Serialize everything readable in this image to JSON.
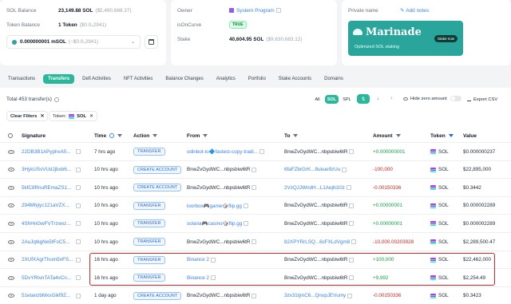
{
  "account": {
    "sol_balance_label": "SOL Balance",
    "sol_balance_value": "23,149.88 SOL",
    "sol_balance_usd": "($5,490,688.37)",
    "token_balance_label": "Token Balance",
    "token_balance_value": "1 Token",
    "token_balance_usd": "($0.0₂2941)",
    "token_select_value": "0.000000001 mSOL",
    "token_select_usd": "(~$0.0₂2941)"
  },
  "owner": {
    "owner_label": "Owner",
    "owner_value": "System Program",
    "oncurve_label": "isOnCurve",
    "oncurve_value": "TRUE",
    "stake_label": "Stake",
    "stake_value": "40,604.95 SOL",
    "stake_usd": "($9,630,683.12)"
  },
  "private": {
    "label": "Private name",
    "add_notes": "Add notes"
  },
  "banner": {
    "brand": "Marinade",
    "tagline": "Optimized SOL staking",
    "button": "Stake now",
    "colors": {
      "bg": "#2aa59b"
    }
  },
  "tabs": [
    "Transactions",
    "Transfers",
    "Defi Activities",
    "NFT Activities",
    "Balance Changes",
    "Analytics",
    "Portfolio",
    "Stake Accounts",
    "Domains"
  ],
  "active_tab": "Transfers",
  "toolbar": {
    "total": "Total 453 transfer(s)",
    "seg_all": "All",
    "seg_sol": "SOL",
    "seg_spl": "SPL",
    "hide_zero": "Hide zero amount",
    "export": "Export CSV",
    "clear_filters": "Clear Filters",
    "token_filter_label": "Token:",
    "token_filter_value": "SOL"
  },
  "columns": {
    "signature": "Signature",
    "time": "Time",
    "action": "Action",
    "from": "From",
    "to": "To",
    "amount": "Amount",
    "token": "Token",
    "value": "Value"
  },
  "rows": [
    {
      "sig": "22DB3B1APyphvA5...",
      "time": "7 hrs ago",
      "action": "TRANSFER",
      "from": "odinbot-io🔷fastest-copy-tradi...",
      "to": "BnwZvGydWC...nbpsbiw6tR",
      "amount": "+0.000000001",
      "token": "SOL",
      "value": "$0.000000237"
    },
    {
      "sig": "3HykUSvVUdJjbxb6...",
      "time": "10 hrs ago",
      "action": "CREATE ACCOUNT",
      "from": "BnwZvGydWC...nbpsbiw6tR",
      "to": "6faFZbrGrK...8ukue9zUu",
      "amount": "-100,000",
      "token": "SOL",
      "value": "$22,895,000"
    },
    {
      "sig": "5kfC8RnuREmaZS1...",
      "time": "10 hrs ago",
      "action": "CREATE ACCOUNT",
      "from": "BnwZvGydWC...nbpsbiw6tR",
      "to": "2VzQJJWndH...L1Aejhi10z",
      "amount": "-0.00150336",
      "token": "SOL",
      "value": "$0.3442"
    },
    {
      "sig": "294Mhjiyc121aVZX...",
      "time": "10 hrs ago",
      "action": "TRANSFER",
      "from": "loorbox🎮game🎲flip.gg",
      "to": "BnwZvGydWC...nbpsbiw6tR",
      "amount": "+0.00000001",
      "token": "SOL",
      "value": "$0.000002289"
    },
    {
      "sig": "4ShHnGwFVTrzwxz...",
      "time": "10 hrs ago",
      "action": "TRANSFER",
      "from": "solana🎮casino🎲flip.gg",
      "to": "BnwZvGydWC...nbpsbiw6tR",
      "amount": "+0.00000001",
      "token": "SOL",
      "value": "$0.000002289"
    },
    {
      "sig": "2AuJqtkgNe5tFoC5...",
      "time": "10 hrs ago",
      "action": "TRANSFER",
      "from": "BnwZvGydWC...nbpsbiw6tR",
      "to": "82XPYRrLSQ...6cFXLdVgm8",
      "amount": "-10,000.00203928",
      "token": "SOL",
      "value": "$2,289,500.47"
    },
    {
      "sig": "2XUfXAgrThum5nFS...",
      "time": "16 hrs ago",
      "action": "TRANSFER",
      "from": "Binance 2",
      "to": "BnwZvGydWC...nbpsbiw6tR",
      "amount": "+100,000",
      "token": "SOL",
      "value": "$22,462,000"
    },
    {
      "sig": "5DvYRtvnTATa4vCn...",
      "time": "16 hrs ago",
      "action": "TRANSFER",
      "from": "Binance 2",
      "to": "BnwZvGydWC...nbpsbiw6tR",
      "amount": "+9,992",
      "token": "SOL",
      "value": "$2,254.49"
    },
    {
      "sig": "51etanzbMxsGikf9Z...",
      "time": "1 day ago",
      "action": "CREATE ACCOUNT",
      "from": "BnwZvGydWC...nbpsbiw6tR",
      "to": "3zx31tjmC6...QnopJEVumy",
      "amount": "-0.00150336",
      "token": "SOL",
      "value": "$0.3423"
    }
  ]
}
